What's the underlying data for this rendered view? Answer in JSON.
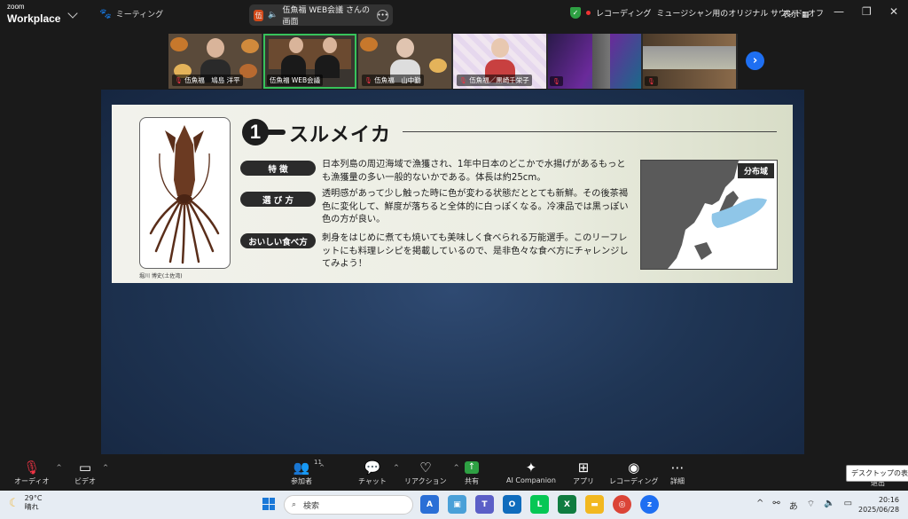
{
  "app": {
    "logo_small": "zoom",
    "logo_big": "Workplace"
  },
  "header": {
    "meeting_label": "ミーティング",
    "share_tab_avatar": "伍",
    "share_tab_label": "伍魚福 WEB会議 さんの画面",
    "recording_text": "レコーディング",
    "sound_text": "ミュージシャン用のオリジナル サウンド: オフ",
    "display_label": "表示"
  },
  "participants": [
    {
      "name": "伍魚福　鳩島 洋平"
    },
    {
      "name": "伍魚福 WEB会議"
    },
    {
      "name": "伍魚福　山中勤"
    },
    {
      "name": "伍魚福／黒崎千栄子"
    },
    {
      "name": ""
    },
    {
      "name": ""
    }
  ],
  "slide": {
    "number": "1",
    "title": "スルメイカ",
    "credit": "堀川 博史(土佐湾)",
    "rows": [
      {
        "label": "特 徴",
        "text": "日本列島の周辺海域で漁獲され、1年中日本のどこかで水揚げがあるもっとも漁獲量の多い一般的ないかである。体長は約25cm。"
      },
      {
        "label": "選 び 方",
        "text": "透明感があって少し触った時に色が変わる状態だととても新鮮。その後茶褐色に変化して、鮮度が落ちると全体的に白っぽくなる。冷凍品では黒っぽい色の方が良い。"
      },
      {
        "label": "おいしい食べ方",
        "text": "刺身をはじめに煮ても焼いても美味しく食べられる万能選手。このリーフレットにも料理レシピを掲載しているので、是非色々な食べ方にチャレンジしてみよう！"
      }
    ],
    "map_label": "分布域"
  },
  "toolbar": {
    "audio": "オーディオ",
    "video": "ビデオ",
    "participants": "参加者",
    "participant_count": "11",
    "chat": "チャット",
    "reactions": "リアクション",
    "share": "共有",
    "ai": "AI Companion",
    "apps": "アプリ",
    "recording": "レコーディング",
    "more": "詳細",
    "end": "退出",
    "tooltip": "デスクトップの表示"
  },
  "taskbar": {
    "temp": "29°C",
    "weather": "晴れ",
    "search_placeholder": "検索",
    "ime": "あ",
    "time": "20:16",
    "date": "2025/06/28"
  },
  "colors": {
    "accent": "#37c35b",
    "share_bg": "#1f3554",
    "zoom_blue": "#1e6ff2"
  }
}
